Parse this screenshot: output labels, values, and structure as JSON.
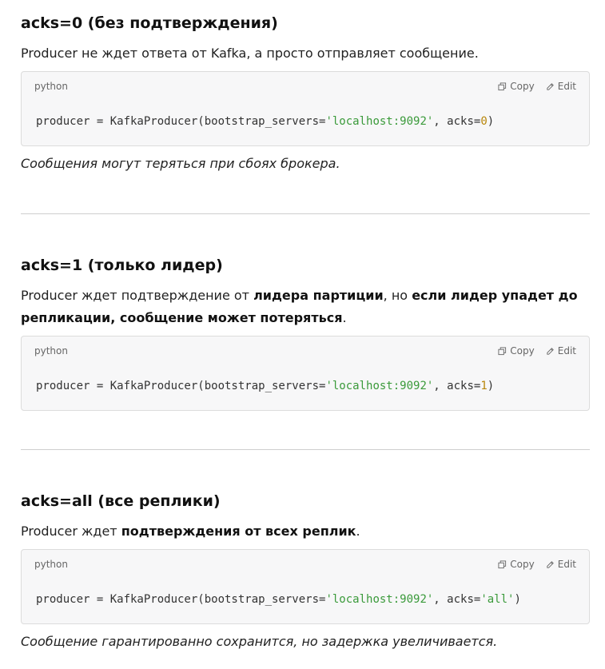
{
  "sections": [
    {
      "heading": "acks=0 (без подтверждения)",
      "text": "Producer не ждет ответа от Kafka, а просто отправляет сообщение.",
      "code": {
        "lang": "python",
        "copy": "Copy",
        "edit": "Edit",
        "prefix": "producer = KafkaProducer(bootstrap_servers=",
        "str": "'localhost:9092'",
        "mid": ", acks=",
        "val": "0",
        "suffix": ")"
      },
      "note": "Сообщения могут теряться при сбоях брокера."
    },
    {
      "heading": "acks=1 (только лидер)",
      "text_parts": {
        "a": "Producer ждет подтверждение от ",
        "b": "лидера партиции",
        "c": ", но ",
        "d": "если лидер упадет до репликации, сообщение может потеряться",
        "e": "."
      },
      "code": {
        "lang": "python",
        "copy": "Copy",
        "edit": "Edit",
        "prefix": "producer = KafkaProducer(bootstrap_servers=",
        "str": "'localhost:9092'",
        "mid": ", acks=",
        "val": "1",
        "suffix": ")"
      }
    },
    {
      "heading": "acks=all (все реплики)",
      "text_parts": {
        "a": "Producer ждет ",
        "b": "подтверждения от всех реплик",
        "c": "."
      },
      "code": {
        "lang": "python",
        "copy": "Copy",
        "edit": "Edit",
        "prefix": "producer = KafkaProducer(bootstrap_servers=",
        "str": "'localhost:9092'",
        "mid": ", acks=",
        "val": "'all'",
        "suffix": ")"
      },
      "note": "Сообщение гарантированно сохранится, но задержка увеличивается."
    }
  ],
  "colors": {
    "string": "#3a9a3a",
    "number": "#b8860b",
    "code_bg": "#f7f7f8"
  },
  "icons": {
    "copy": "copy-icon",
    "edit": "edit-icon"
  }
}
